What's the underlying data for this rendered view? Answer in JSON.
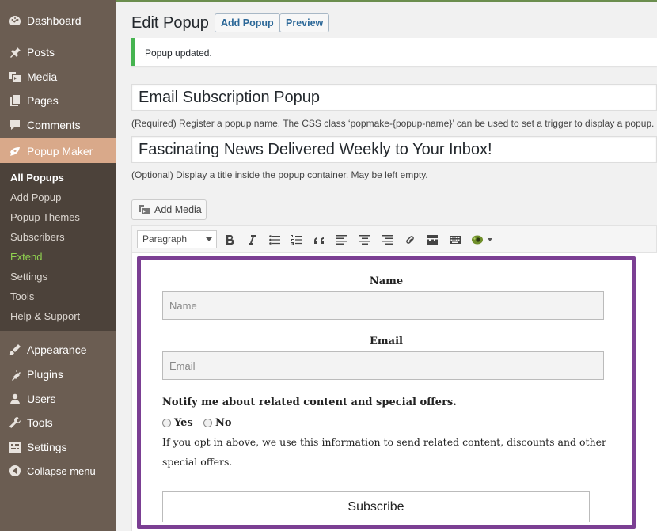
{
  "sidebar": {
    "items": [
      {
        "label": "Dashboard",
        "icon": "dashboard-icon"
      },
      {
        "label": "Posts",
        "icon": "pin-icon"
      },
      {
        "label": "Media",
        "icon": "media-icon"
      },
      {
        "label": "Pages",
        "icon": "pages-icon"
      },
      {
        "label": "Comments",
        "icon": "comments-icon"
      },
      {
        "label": "Popup Maker",
        "icon": "popup-maker-icon"
      }
    ],
    "submenu": [
      "All Popups",
      "Add Popup",
      "Popup Themes",
      "Subscribers",
      "Extend",
      "Settings",
      "Tools",
      "Help & Support"
    ],
    "items_bottom": [
      {
        "label": "Appearance",
        "icon": "appearance-icon"
      },
      {
        "label": "Plugins",
        "icon": "plugins-icon"
      },
      {
        "label": "Users",
        "icon": "users-icon"
      },
      {
        "label": "Tools",
        "icon": "tools-icon"
      },
      {
        "label": "Settings",
        "icon": "settings-icon"
      },
      {
        "label": "Collapse menu",
        "icon": "collapse-icon"
      }
    ]
  },
  "header": {
    "title": "Edit Popup",
    "add_button": "Add Popup",
    "preview_button": "Preview"
  },
  "notice": "Popup updated.",
  "popup_name": {
    "value": "Email Subscription Popup",
    "help": "(Required) Register a popup name. The CSS class ‘popmake-{popup-name}’ can be used to set a trigger to display a popup."
  },
  "popup_title": {
    "value": "Fascinating News Delivered Weekly to Your Inbox!",
    "help": "(Optional) Display a title inside the popup container. May be left empty."
  },
  "editor": {
    "add_media": "Add Media",
    "format": "Paragraph"
  },
  "form": {
    "name_label": "Name",
    "name_placeholder": "Name",
    "email_label": "Email",
    "email_placeholder": "Email",
    "notify_question": "Notify me about related content and special offers.",
    "yes": "Yes",
    "no": "No",
    "note_line1": "If you opt in above, we use this information to send related content, discounts and other",
    "note_line2": "special offers.",
    "subscribe": "Subscribe"
  },
  "colors": {
    "sidebar": "#6b5d52",
    "submenu": "#4c423a",
    "current": "#d9a98a",
    "form_border": "#7b3f93",
    "notice_border": "#46b450",
    "link": "#2c6898"
  }
}
